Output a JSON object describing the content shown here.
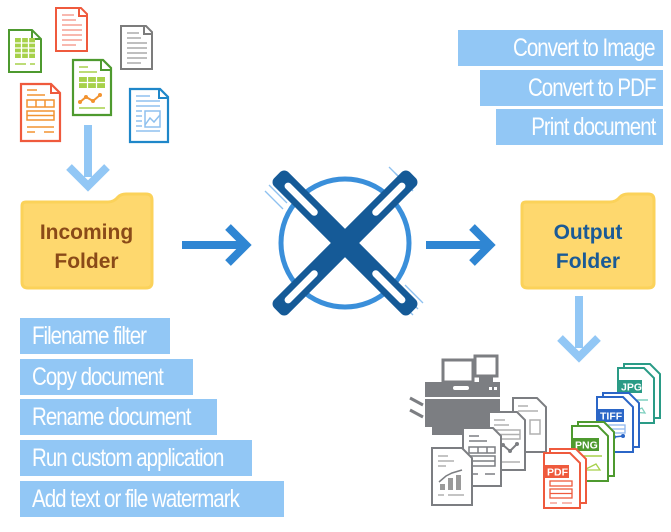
{
  "diagram": {
    "incoming_folder": {
      "line1": "Incoming",
      "line2": "Folder",
      "text_color": "#8a4a18"
    },
    "output_folder": {
      "line1": "Output",
      "line2": "Folder",
      "text_color": "#1a5a96"
    },
    "incoming_actions": [
      "Filename filter",
      "Copy document",
      "Rename document",
      "Run custom application",
      "Add text or file watermark"
    ],
    "output_actions": [
      "Convert  to Image",
      "Convert to PDF",
      "Print document"
    ],
    "output_formats": [
      "PDF",
      "PNG",
      "TIFF",
      "JPG"
    ],
    "colors": {
      "tag_bg": "#92c7f5",
      "folder_fill": "#fed86e",
      "folder_border": "#fbd25a",
      "arrow_light": "#92c7f5",
      "arrow_dark": "#2f86d3",
      "engine_blue": "#155a97",
      "engine_ring": "#3a8fda"
    },
    "icons": {
      "incoming_documents": [
        "spreadsheet-doc-icon",
        "text-doc-icon-red",
        "text-doc-icon-gray",
        "chart-doc-icon",
        "form-doc-icon",
        "image-doc-icon"
      ],
      "engine": "propeller-processing-icon",
      "printer": "printer-icon",
      "output_docs": [
        "pdf-file-icon",
        "png-file-icon",
        "tiff-file-icon",
        "jpg-file-icon"
      ]
    }
  }
}
